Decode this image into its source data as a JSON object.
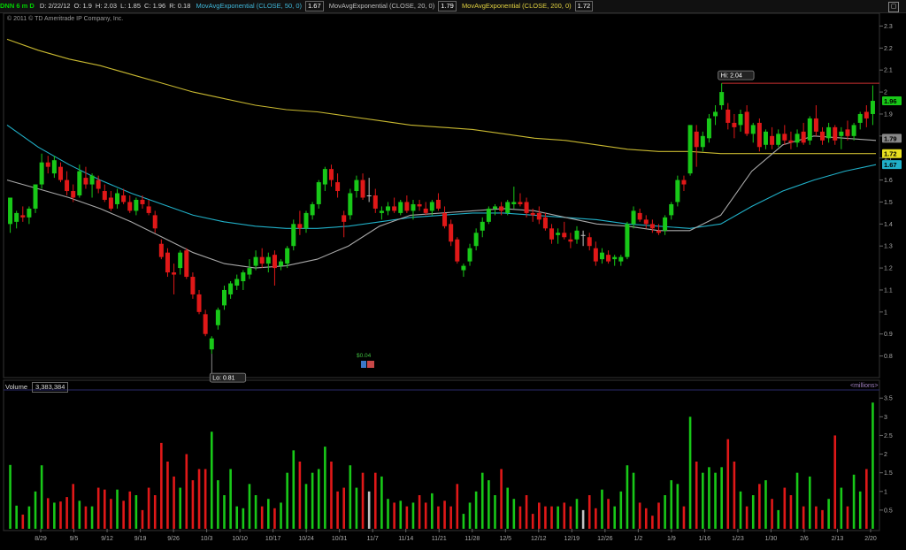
{
  "header": {
    "symbol": "DNN 6 m D",
    "date": "D: 2/22/12",
    "open": "O: 1.9",
    "high": "H: 2.03",
    "low": "L: 1.85",
    "close": "C: 1.96",
    "range": "R: 0.18",
    "ema50_label": "MovAvgExponential (CLOSE, 50, 0)",
    "ema50_value": "1.67",
    "ema20_label": "MovAvgExponential (CLOSE, 20, 0)",
    "ema20_value": "1.79",
    "ema200_label": "MovAvgExponential (CLOSE, 200, 0)",
    "ema200_value": "1.72"
  },
  "copyright": "© 2011 © TD Ameritrade IP Company, Inc.",
  "volume_panel": {
    "label": "Volume",
    "value": "3,383,384",
    "units": "<millions>"
  },
  "colors": {
    "up": "#18c818",
    "down": "#e01818",
    "neutral": "#c0c0c0",
    "ema20": "#a8a8a8",
    "ema50": "#20b0c8",
    "ema200": "#c8b830",
    "hi_line": "#c83030"
  },
  "chart_data": {
    "type": "candlestick",
    "y_ticks": [
      "2.3",
      "2.2",
      "2.1",
      "2",
      "1.9",
      "1.8",
      "1.7",
      "1.6",
      "1.5",
      "1.4",
      "1.3",
      "1.2",
      "1.1",
      "1",
      "0.9",
      "0.8"
    ],
    "ylim": [
      0.73,
      2.33
    ],
    "volume_ticks": [
      "3.5",
      "3",
      "2.5",
      "2",
      "1.5",
      "1",
      "0.5"
    ],
    "volume_ylim": [
      0,
      3.6
    ],
    "x_tick_labels": [
      "8/29",
      "9/5",
      "9/12",
      "9/19",
      "9/26",
      "10/3",
      "10/10",
      "10/17",
      "10/24",
      "10/31",
      "11/7",
      "11/14",
      "11/21",
      "11/28",
      "12/5",
      "12/12",
      "12/19",
      "12/26",
      "1/2",
      "1/9",
      "1/16",
      "1/23",
      "1/30",
      "2/6",
      "2/13",
      "2/20"
    ],
    "hi_label": "Hi: 2.04",
    "lo_label": "Lo: 0.81",
    "dividend_label": "$0.04",
    "last_price": "1.96",
    "ema_labels": [
      "1.79",
      "1.72",
      "1.67"
    ],
    "candles": [
      {
        "o": 1.4,
        "h": 1.52,
        "l": 1.36,
        "c": 1.52,
        "v": 1.71
      },
      {
        "o": 1.41,
        "h": 1.46,
        "l": 1.38,
        "c": 1.45,
        "v": 0.62
      },
      {
        "o": 1.44,
        "h": 1.48,
        "l": 1.41,
        "c": 1.43,
        "v": 0.38
      },
      {
        "o": 1.43,
        "h": 1.48,
        "l": 1.4,
        "c": 1.47,
        "v": 0.6
      },
      {
        "o": 1.47,
        "h": 1.58,
        "l": 1.45,
        "c": 1.58,
        "v": 1.0
      },
      {
        "o": 1.58,
        "h": 1.72,
        "l": 1.56,
        "c": 1.68,
        "v": 1.7
      },
      {
        "o": 1.68,
        "h": 1.71,
        "l": 1.63,
        "c": 1.66,
        "v": 0.82
      },
      {
        "o": 1.63,
        "h": 1.71,
        "l": 1.61,
        "c": 1.69,
        "v": 0.7
      },
      {
        "o": 1.66,
        "h": 1.68,
        "l": 1.59,
        "c": 1.6,
        "v": 0.73
      },
      {
        "o": 1.6,
        "h": 1.64,
        "l": 1.53,
        "c": 1.55,
        "v": 0.85
      },
      {
        "o": 1.55,
        "h": 1.58,
        "l": 1.5,
        "c": 1.52,
        "v": 1.2
      },
      {
        "o": 1.53,
        "h": 1.67,
        "l": 1.52,
        "c": 1.64,
        "v": 0.75
      },
      {
        "o": 1.61,
        "h": 1.66,
        "l": 1.56,
        "c": 1.58,
        "v": 0.6
      },
      {
        "o": 1.58,
        "h": 1.63,
        "l": 1.52,
        "c": 1.62,
        "v": 0.6
      },
      {
        "o": 1.6,
        "h": 1.62,
        "l": 1.54,
        "c": 1.56,
        "v": 1.1
      },
      {
        "o": 1.55,
        "h": 1.58,
        "l": 1.5,
        "c": 1.51,
        "v": 1.05
      },
      {
        "o": 1.52,
        "h": 1.55,
        "l": 1.46,
        "c": 1.47,
        "v": 0.8
      },
      {
        "o": 1.49,
        "h": 1.56,
        "l": 1.47,
        "c": 1.54,
        "v": 1.05
      },
      {
        "o": 1.53,
        "h": 1.56,
        "l": 1.49,
        "c": 1.5,
        "v": 0.75
      },
      {
        "o": 1.5,
        "h": 1.53,
        "l": 1.45,
        "c": 1.46,
        "v": 1.0
      },
      {
        "o": 1.46,
        "h": 1.52,
        "l": 1.44,
        "c": 1.51,
        "v": 0.9
      },
      {
        "o": 1.51,
        "h": 1.53,
        "l": 1.47,
        "c": 1.49,
        "v": 0.5
      },
      {
        "o": 1.48,
        "h": 1.51,
        "l": 1.44,
        "c": 1.45,
        "v": 1.1
      },
      {
        "o": 1.44,
        "h": 1.46,
        "l": 1.36,
        "c": 1.38,
        "v": 0.9
      },
      {
        "o": 1.31,
        "h": 1.33,
        "l": 1.24,
        "c": 1.25,
        "v": 2.3
      },
      {
        "o": 1.27,
        "h": 1.29,
        "l": 1.16,
        "c": 1.18,
        "v": 1.8
      },
      {
        "o": 1.18,
        "h": 1.22,
        "l": 1.08,
        "c": 1.17,
        "v": 1.4
      },
      {
        "o": 1.2,
        "h": 1.28,
        "l": 1.17,
        "c": 1.27,
        "v": 1.1
      },
      {
        "o": 1.28,
        "h": 1.29,
        "l": 1.15,
        "c": 1.16,
        "v": 2.0
      },
      {
        "o": 1.16,
        "h": 1.18,
        "l": 1.06,
        "c": 1.08,
        "v": 1.3
      },
      {
        "o": 1.08,
        "h": 1.1,
        "l": 0.99,
        "c": 1.0,
        "v": 1.6
      },
      {
        "o": 0.99,
        "h": 1.01,
        "l": 0.89,
        "c": 0.9,
        "v": 1.6
      },
      {
        "o": 0.83,
        "h": 0.89,
        "l": 0.81,
        "c": 0.88,
        "v": 2.6
      },
      {
        "o": 0.94,
        "h": 1.02,
        "l": 0.92,
        "c": 1.01,
        "v": 1.3
      },
      {
        "o": 1.03,
        "h": 1.12,
        "l": 1.01,
        "c": 1.1,
        "v": 0.9
      },
      {
        "o": 1.08,
        "h": 1.14,
        "l": 1.06,
        "c": 1.13,
        "v": 1.6
      },
      {
        "o": 1.12,
        "h": 1.17,
        "l": 1.1,
        "c": 1.15,
        "v": 0.6
      },
      {
        "o": 1.14,
        "h": 1.19,
        "l": 1.1,
        "c": 1.18,
        "v": 0.55
      },
      {
        "o": 1.17,
        "h": 1.24,
        "l": 1.15,
        "c": 1.2,
        "v": 1.2
      },
      {
        "o": 1.21,
        "h": 1.28,
        "l": 1.19,
        "c": 1.25,
        "v": 0.9
      },
      {
        "o": 1.25,
        "h": 1.29,
        "l": 1.2,
        "c": 1.22,
        "v": 0.6
      },
      {
        "o": 1.22,
        "h": 1.27,
        "l": 1.18,
        "c": 1.25,
        "v": 0.8
      },
      {
        "o": 1.26,
        "h": 1.28,
        "l": 1.12,
        "c": 1.2,
        "v": 0.55
      },
      {
        "o": 1.21,
        "h": 1.24,
        "l": 1.19,
        "c": 1.23,
        "v": 0.7
      },
      {
        "o": 1.22,
        "h": 1.3,
        "l": 1.2,
        "c": 1.29,
        "v": 1.5
      },
      {
        "o": 1.3,
        "h": 1.42,
        "l": 1.28,
        "c": 1.4,
        "v": 2.1
      },
      {
        "o": 1.4,
        "h": 1.46,
        "l": 1.35,
        "c": 1.38,
        "v": 1.8
      },
      {
        "o": 1.38,
        "h": 1.46,
        "l": 1.36,
        "c": 1.45,
        "v": 1.2
      },
      {
        "o": 1.44,
        "h": 1.5,
        "l": 1.42,
        "c": 1.49,
        "v": 1.5
      },
      {
        "o": 1.49,
        "h": 1.6,
        "l": 1.47,
        "c": 1.59,
        "v": 1.6
      },
      {
        "o": 1.58,
        "h": 1.66,
        "l": 1.55,
        "c": 1.65,
        "v": 2.2
      },
      {
        "o": 1.65,
        "h": 1.67,
        "l": 1.57,
        "c": 1.6,
        "v": 1.8
      },
      {
        "o": 1.59,
        "h": 1.63,
        "l": 1.52,
        "c": 1.55,
        "v": 1.0
      },
      {
        "o": 1.44,
        "h": 1.46,
        "l": 1.34,
        "c": 1.41,
        "v": 1.1
      },
      {
        "o": 1.44,
        "h": 1.56,
        "l": 1.42,
        "c": 1.54,
        "v": 1.7
      },
      {
        "o": 1.55,
        "h": 1.62,
        "l": 1.52,
        "c": 1.6,
        "v": 1.1
      },
      {
        "o": 1.6,
        "h": 1.63,
        "l": 1.51,
        "c": 1.52,
        "v": 1.5
      },
      {
        "o": 1.53,
        "h": 1.61,
        "l": 1.5,
        "c": 1.53,
        "v": 1.0
      },
      {
        "o": 1.53,
        "h": 1.56,
        "l": 1.45,
        "c": 1.47,
        "v": 1.5
      },
      {
        "o": 1.45,
        "h": 1.48,
        "l": 1.42,
        "c": 1.46,
        "v": 1.4
      },
      {
        "o": 1.46,
        "h": 1.5,
        "l": 1.44,
        "c": 1.48,
        "v": 0.8
      },
      {
        "o": 1.48,
        "h": 1.52,
        "l": 1.45,
        "c": 1.46,
        "v": 0.7
      },
      {
        "o": 1.45,
        "h": 1.51,
        "l": 1.44,
        "c": 1.5,
        "v": 0.75
      },
      {
        "o": 1.5,
        "h": 1.53,
        "l": 1.45,
        "c": 1.46,
        "v": 0.6
      },
      {
        "o": 1.46,
        "h": 1.51,
        "l": 1.42,
        "c": 1.49,
        "v": 0.7
      },
      {
        "o": 1.49,
        "h": 1.51,
        "l": 1.46,
        "c": 1.48,
        "v": 0.9
      },
      {
        "o": 1.47,
        "h": 1.5,
        "l": 1.44,
        "c": 1.45,
        "v": 0.7
      },
      {
        "o": 1.46,
        "h": 1.51,
        "l": 1.44,
        "c": 1.5,
        "v": 0.95
      },
      {
        "o": 1.51,
        "h": 1.54,
        "l": 1.46,
        "c": 1.47,
        "v": 0.6
      },
      {
        "o": 1.45,
        "h": 1.48,
        "l": 1.38,
        "c": 1.39,
        "v": 0.75
      },
      {
        "o": 1.4,
        "h": 1.42,
        "l": 1.3,
        "c": 1.32,
        "v": 0.6
      },
      {
        "o": 1.33,
        "h": 1.34,
        "l": 1.22,
        "c": 1.23,
        "v": 1.2
      },
      {
        "o": 1.19,
        "h": 1.22,
        "l": 1.16,
        "c": 1.21,
        "v": 0.4
      },
      {
        "o": 1.23,
        "h": 1.31,
        "l": 1.21,
        "c": 1.29,
        "v": 0.7
      },
      {
        "o": 1.3,
        "h": 1.38,
        "l": 1.28,
        "c": 1.36,
        "v": 1.0
      },
      {
        "o": 1.37,
        "h": 1.43,
        "l": 1.34,
        "c": 1.41,
        "v": 1.5
      },
      {
        "o": 1.41,
        "h": 1.48,
        "l": 1.4,
        "c": 1.47,
        "v": 1.3
      },
      {
        "o": 1.47,
        "h": 1.49,
        "l": 1.44,
        "c": 1.48,
        "v": 0.9
      },
      {
        "o": 1.48,
        "h": 1.5,
        "l": 1.44,
        "c": 1.46,
        "v": 1.6
      },
      {
        "o": 1.45,
        "h": 1.51,
        "l": 1.44,
        "c": 1.5,
        "v": 1.1
      },
      {
        "o": 1.49,
        "h": 1.57,
        "l": 1.47,
        "c": 1.5,
        "v": 0.8
      },
      {
        "o": 1.5,
        "h": 1.54,
        "l": 1.48,
        "c": 1.49,
        "v": 0.6
      },
      {
        "o": 1.5,
        "h": 1.52,
        "l": 1.43,
        "c": 1.45,
        "v": 0.9
      },
      {
        "o": 1.45,
        "h": 1.47,
        "l": 1.41,
        "c": 1.44,
        "v": 0.4
      },
      {
        "o": 1.45,
        "h": 1.48,
        "l": 1.4,
        "c": 1.42,
        "v": 0.7
      },
      {
        "o": 1.43,
        "h": 1.45,
        "l": 1.37,
        "c": 1.38,
        "v": 0.6
      },
      {
        "o": 1.38,
        "h": 1.4,
        "l": 1.31,
        "c": 1.33,
        "v": 0.6
      },
      {
        "o": 1.35,
        "h": 1.38,
        "l": 1.31,
        "c": 1.36,
        "v": 0.6
      },
      {
        "o": 1.36,
        "h": 1.41,
        "l": 1.33,
        "c": 1.34,
        "v": 0.7
      },
      {
        "o": 1.33,
        "h": 1.36,
        "l": 1.29,
        "c": 1.32,
        "v": 0.6
      },
      {
        "o": 1.33,
        "h": 1.39,
        "l": 1.31,
        "c": 1.37,
        "v": 0.8
      },
      {
        "o": 1.35,
        "h": 1.37,
        "l": 1.3,
        "c": 1.35,
        "v": 0.5
      },
      {
        "o": 1.34,
        "h": 1.36,
        "l": 1.28,
        "c": 1.3,
        "v": 0.9
      },
      {
        "o": 1.29,
        "h": 1.32,
        "l": 1.21,
        "c": 1.23,
        "v": 0.55
      },
      {
        "o": 1.24,
        "h": 1.29,
        "l": 1.22,
        "c": 1.27,
        "v": 1.05
      },
      {
        "o": 1.26,
        "h": 1.28,
        "l": 1.22,
        "c": 1.23,
        "v": 0.8
      },
      {
        "o": 1.24,
        "h": 1.26,
        "l": 1.21,
        "c": 1.25,
        "v": 0.6
      },
      {
        "o": 1.23,
        "h": 1.26,
        "l": 1.21,
        "c": 1.25,
        "v": 1.0
      },
      {
        "o": 1.25,
        "h": 1.41,
        "l": 1.24,
        "c": 1.4,
        "v": 1.7
      },
      {
        "o": 1.4,
        "h": 1.48,
        "l": 1.38,
        "c": 1.46,
        "v": 1.5
      },
      {
        "o": 1.45,
        "h": 1.47,
        "l": 1.41,
        "c": 1.42,
        "v": 0.7
      },
      {
        "o": 1.42,
        "h": 1.44,
        "l": 1.38,
        "c": 1.4,
        "v": 0.55
      },
      {
        "o": 1.4,
        "h": 1.42,
        "l": 1.36,
        "c": 1.38,
        "v": 0.35
      },
      {
        "o": 1.37,
        "h": 1.4,
        "l": 1.35,
        "c": 1.36,
        "v": 0.7
      },
      {
        "o": 1.37,
        "h": 1.44,
        "l": 1.35,
        "c": 1.43,
        "v": 0.9
      },
      {
        "o": 1.44,
        "h": 1.5,
        "l": 1.42,
        "c": 1.49,
        "v": 1.3
      },
      {
        "o": 1.5,
        "h": 1.62,
        "l": 1.48,
        "c": 1.6,
        "v": 1.2
      },
      {
        "o": 1.6,
        "h": 1.62,
        "l": 1.55,
        "c": 1.58,
        "v": 0.6
      },
      {
        "o": 1.63,
        "h": 1.85,
        "l": 1.62,
        "c": 1.85,
        "v": 3.0
      },
      {
        "o": 1.82,
        "h": 1.85,
        "l": 1.66,
        "c": 1.75,
        "v": 1.8
      },
      {
        "o": 1.75,
        "h": 1.82,
        "l": 1.73,
        "c": 1.8,
        "v": 1.5
      },
      {
        "o": 1.79,
        "h": 1.9,
        "l": 1.77,
        "c": 1.88,
        "v": 1.65
      },
      {
        "o": 1.89,
        "h": 1.94,
        "l": 1.85,
        "c": 1.91,
        "v": 1.5
      },
      {
        "o": 1.94,
        "h": 2.04,
        "l": 1.92,
        "c": 2.0,
        "v": 1.65
      },
      {
        "o": 1.92,
        "h": 1.95,
        "l": 1.83,
        "c": 1.86,
        "v": 2.4
      },
      {
        "o": 1.86,
        "h": 1.9,
        "l": 1.79,
        "c": 1.84,
        "v": 1.8
      },
      {
        "o": 1.85,
        "h": 1.92,
        "l": 1.82,
        "c": 1.9,
        "v": 1.0
      },
      {
        "o": 1.91,
        "h": 1.94,
        "l": 1.8,
        "c": 1.81,
        "v": 0.6
      },
      {
        "o": 1.81,
        "h": 1.86,
        "l": 1.77,
        "c": 1.85,
        "v": 0.9
      },
      {
        "o": 1.86,
        "h": 1.88,
        "l": 1.73,
        "c": 1.75,
        "v": 1.2
      },
      {
        "o": 1.76,
        "h": 1.83,
        "l": 1.74,
        "c": 1.82,
        "v": 1.3
      },
      {
        "o": 1.8,
        "h": 1.84,
        "l": 1.74,
        "c": 1.76,
        "v": 0.8
      },
      {
        "o": 1.76,
        "h": 1.83,
        "l": 1.75,
        "c": 1.81,
        "v": 0.5
      },
      {
        "o": 1.81,
        "h": 1.85,
        "l": 1.76,
        "c": 1.78,
        "v": 1.1
      },
      {
        "o": 1.78,
        "h": 1.82,
        "l": 1.74,
        "c": 1.77,
        "v": 0.9
      },
      {
        "o": 1.77,
        "h": 1.83,
        "l": 1.75,
        "c": 1.81,
        "v": 1.5
      },
      {
        "o": 1.82,
        "h": 1.86,
        "l": 1.76,
        "c": 1.77,
        "v": 0.6
      },
      {
        "o": 1.78,
        "h": 1.89,
        "l": 1.76,
        "c": 1.88,
        "v": 1.4
      },
      {
        "o": 1.88,
        "h": 1.94,
        "l": 1.8,
        "c": 1.82,
        "v": 0.6
      },
      {
        "o": 1.82,
        "h": 1.84,
        "l": 1.76,
        "c": 1.78,
        "v": 0.5
      },
      {
        "o": 1.79,
        "h": 1.86,
        "l": 1.77,
        "c": 1.84,
        "v": 0.8
      },
      {
        "o": 1.84,
        "h": 1.85,
        "l": 1.76,
        "c": 1.78,
        "v": 2.5
      },
      {
        "o": 1.8,
        "h": 1.84,
        "l": 1.74,
        "c": 1.82,
        "v": 1.1
      },
      {
        "o": 1.83,
        "h": 1.87,
        "l": 1.78,
        "c": 1.8,
        "v": 0.6
      },
      {
        "o": 1.8,
        "h": 1.86,
        "l": 1.78,
        "c": 1.85,
        "v": 1.45
      },
      {
        "o": 1.86,
        "h": 1.91,
        "l": 1.83,
        "c": 1.9,
        "v": 1.0
      },
      {
        "o": 1.91,
        "h": 1.94,
        "l": 1.84,
        "c": 1.88,
        "v": 1.6
      },
      {
        "o": 1.9,
        "h": 2.03,
        "l": 1.85,
        "c": 1.96,
        "v": 3.38
      }
    ],
    "ema20": [
      1.6,
      1.56,
      1.52,
      1.47,
      1.41,
      1.34,
      1.27,
      1.22,
      1.2,
      1.21,
      1.24,
      1.3,
      1.39,
      1.44,
      1.45,
      1.46,
      1.47,
      1.46,
      1.43,
      1.4,
      1.39,
      1.37,
      1.37,
      1.44,
      1.64,
      1.76,
      1.8,
      1.79,
      1.78
    ],
    "ema50": [
      1.85,
      1.75,
      1.67,
      1.6,
      1.54,
      1.49,
      1.44,
      1.41,
      1.39,
      1.38,
      1.38,
      1.39,
      1.41,
      1.43,
      1.44,
      1.45,
      1.45,
      1.44,
      1.43,
      1.42,
      1.4,
      1.39,
      1.38,
      1.4,
      1.48,
      1.55,
      1.6,
      1.64,
      1.67
    ],
    "ema200": [
      2.24,
      2.19,
      2.15,
      2.12,
      2.08,
      2.04,
      2.0,
      1.97,
      1.94,
      1.92,
      1.91,
      1.89,
      1.87,
      1.85,
      1.84,
      1.83,
      1.81,
      1.79,
      1.78,
      1.76,
      1.74,
      1.73,
      1.73,
      1.72,
      1.72,
      1.72,
      1.72,
      1.72,
      1.72
    ]
  }
}
